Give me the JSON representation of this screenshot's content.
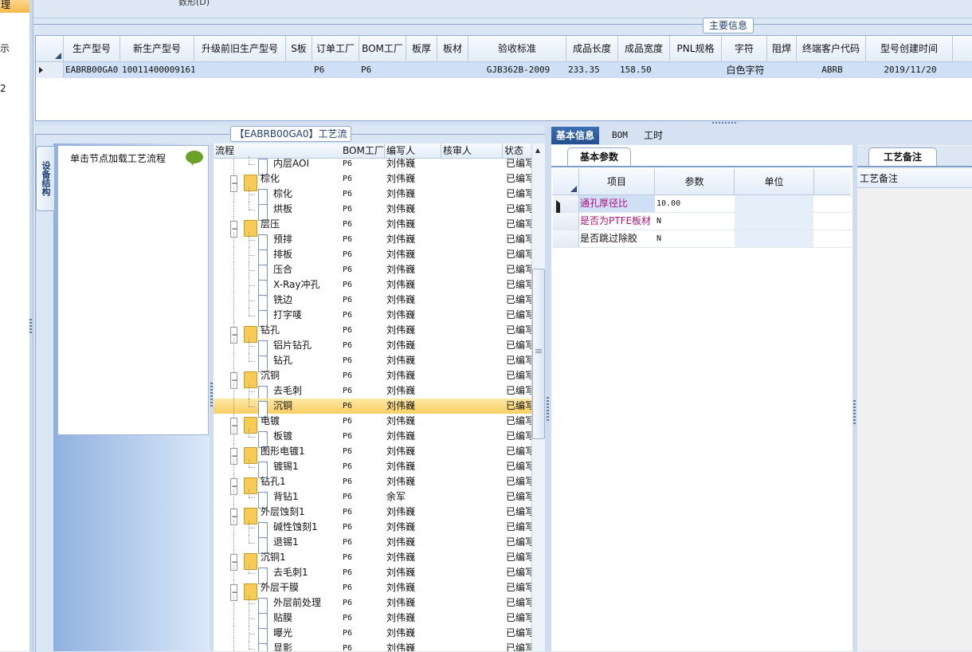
{
  "sidebar": {
    "active_label": "理",
    "labels": [
      "示",
      "2"
    ]
  },
  "toolbar": {
    "cut_text": "数形(D)"
  },
  "main_info": {
    "title": "主要信息",
    "columns": [
      "生产型号",
      "新生产型号",
      "升级前旧生产型号",
      "S板",
      "订单工厂",
      "BOM工厂",
      "板厚",
      "板材",
      "验收标准",
      "成品长度",
      "成品宽度",
      "PNL规格",
      "字符",
      "阻焊",
      "终端客户代码",
      "型号创建时间"
    ],
    "row": [
      "EABRB00GA0",
      "10011400009161",
      "",
      "",
      "P6",
      "P6",
      "",
      "",
      "GJB362B-2009",
      "233.35",
      "158.50",
      "",
      "白色字符",
      "",
      "ABRB",
      "2019/11/20"
    ]
  },
  "flow": {
    "title": "【EABRB00GA0】工艺流程",
    "side_tab": "设备结构",
    "hint": "单击节点加载工艺流程",
    "columns": [
      "流程",
      "BOM工厂",
      "编写人",
      "核审人",
      "状态"
    ],
    "rows": [
      {
        "name": "内层AOI",
        "level": 1,
        "factory": "P6",
        "author": "刘伟巍",
        "reviewer": "",
        "status": "已编写"
      },
      {
        "name": "棕化",
        "level": 0,
        "factory": "P6",
        "author": "刘伟巍",
        "reviewer": "",
        "status": "已编写"
      },
      {
        "name": "棕化",
        "level": 1,
        "factory": "P6",
        "author": "刘伟巍",
        "reviewer": "",
        "status": "已编写"
      },
      {
        "name": "烘板",
        "level": 1,
        "factory": "P6",
        "author": "刘伟巍",
        "reviewer": "",
        "status": "已编写"
      },
      {
        "name": "层压",
        "level": 0,
        "factory": "P6",
        "author": "刘伟巍",
        "reviewer": "",
        "status": "已编写"
      },
      {
        "name": "预排",
        "level": 1,
        "factory": "P6",
        "author": "刘伟巍",
        "reviewer": "",
        "status": "已编写"
      },
      {
        "name": "排板",
        "level": 1,
        "factory": "P6",
        "author": "刘伟巍",
        "reviewer": "",
        "status": "已编写"
      },
      {
        "name": "压合",
        "level": 1,
        "factory": "P6",
        "author": "刘伟巍",
        "reviewer": "",
        "status": "已编写"
      },
      {
        "name": "X-Ray冲孔",
        "level": 1,
        "factory": "P6",
        "author": "刘伟巍",
        "reviewer": "",
        "status": "已编写"
      },
      {
        "name": "铣边",
        "level": 1,
        "factory": "P6",
        "author": "刘伟巍",
        "reviewer": "",
        "status": "已编写"
      },
      {
        "name": "打字唛",
        "level": 1,
        "factory": "P6",
        "author": "刘伟巍",
        "reviewer": "",
        "status": "已编写"
      },
      {
        "name": "钻孔",
        "level": 0,
        "factory": "P6",
        "author": "刘伟巍",
        "reviewer": "",
        "status": "已编写"
      },
      {
        "name": "铝片钻孔",
        "level": 1,
        "factory": "P6",
        "author": "刘伟巍",
        "reviewer": "",
        "status": "已编写"
      },
      {
        "name": "钻孔",
        "level": 1,
        "factory": "P6",
        "author": "刘伟巍",
        "reviewer": "",
        "status": "已编写"
      },
      {
        "name": "沉铜",
        "level": 0,
        "factory": "P6",
        "author": "刘伟巍",
        "reviewer": "",
        "status": "已编写"
      },
      {
        "name": "去毛刺",
        "level": 1,
        "factory": "P6",
        "author": "刘伟巍",
        "reviewer": "",
        "status": "已编写"
      },
      {
        "name": "沉铜",
        "level": 1,
        "factory": "P6",
        "author": "刘伟巍",
        "reviewer": "",
        "status": "已编写",
        "selected": true
      },
      {
        "name": "电镀",
        "level": 0,
        "factory": "P6",
        "author": "刘伟巍",
        "reviewer": "",
        "status": "已编写"
      },
      {
        "name": "板镀",
        "level": 1,
        "factory": "P6",
        "author": "刘伟巍",
        "reviewer": "",
        "status": "已编写"
      },
      {
        "name": "图形电镀1",
        "level": 0,
        "factory": "P6",
        "author": "刘伟巍",
        "reviewer": "",
        "status": "已编写"
      },
      {
        "name": "镀锡1",
        "level": 1,
        "factory": "P6",
        "author": "刘伟巍",
        "reviewer": "",
        "status": "已编写"
      },
      {
        "name": "钻孔1",
        "level": 0,
        "factory": "P6",
        "author": "刘伟巍",
        "reviewer": "",
        "status": "已编写"
      },
      {
        "name": "背钻1",
        "level": 1,
        "factory": "P6",
        "author": "余军",
        "reviewer": "",
        "status": "已编写"
      },
      {
        "name": "外层蚀刻1",
        "level": 0,
        "factory": "P6",
        "author": "刘伟巍",
        "reviewer": "",
        "status": "已编写"
      },
      {
        "name": "碱性蚀刻1",
        "level": 1,
        "factory": "P6",
        "author": "刘伟巍",
        "reviewer": "",
        "status": "已编写"
      },
      {
        "name": "退锡1",
        "level": 1,
        "factory": "P6",
        "author": "刘伟巍",
        "reviewer": "",
        "status": "已编写"
      },
      {
        "name": "沉铜1",
        "level": 0,
        "factory": "P6",
        "author": "刘伟巍",
        "reviewer": "",
        "status": "已编写"
      },
      {
        "name": "去毛刺1",
        "level": 1,
        "factory": "P6",
        "author": "刘伟巍",
        "reviewer": "",
        "status": "已编写"
      },
      {
        "name": "外层干膜",
        "level": 0,
        "factory": "P6",
        "author": "刘伟巍",
        "reviewer": "",
        "status": "已编写"
      },
      {
        "name": "外层前处理",
        "level": 1,
        "factory": "P6",
        "author": "刘伟巍",
        "reviewer": "",
        "status": "已编写"
      },
      {
        "name": "贴膜",
        "level": 1,
        "factory": "P6",
        "author": "刘伟巍",
        "reviewer": "",
        "status": "已编写"
      },
      {
        "name": "曝光",
        "level": 1,
        "factory": "P6",
        "author": "刘伟巍",
        "reviewer": "",
        "status": "已编写"
      },
      {
        "name": "显影",
        "level": 1,
        "factory": "P6",
        "author": "刘伟巍",
        "reviewer": "",
        "status": "已编写"
      }
    ]
  },
  "right": {
    "tabs": [
      "基本信息",
      "BOM",
      "工时"
    ],
    "param_tab": "基本参数",
    "param_columns": [
      "项目",
      "参数",
      "单位"
    ],
    "params": [
      {
        "item": "通孔厚径比",
        "value": "10.00",
        "unit": "",
        "color": "#b0127a",
        "selected": true
      },
      {
        "item": "是否为PTFE板材",
        "value": "N",
        "unit": "",
        "color": "#b0127a"
      },
      {
        "item": "是否跳过除胶",
        "value": "N",
        "unit": "",
        "color": "#111111"
      }
    ],
    "note_tab": "工艺备注",
    "note_header": "工艺备注"
  },
  "colors": {
    "selected_row": "#f9cf62",
    "grid_select": "#cfe0f6",
    "accent": "#244f8e"
  }
}
